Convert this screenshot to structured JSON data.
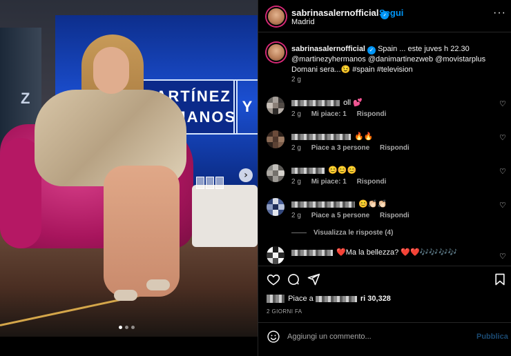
{
  "post": {
    "username": "sabrinasalernofficial",
    "follow_label": "Segui",
    "separator": "•",
    "location": "Madrid",
    "more_label": "···",
    "verified_mark": "✓",
    "caption_text": "Spain ... este juves h 22.30 @martinezyhermanos @danimartinezweb @movistarplus Domani sera...😉 #spain #television",
    "caption_time": "2 g"
  },
  "photo": {
    "sign_line1": "MARTÍNEZ",
    "sign_line2": "HERMANOS",
    "sign_y": "Y",
    "wall_letter": "Z",
    "next_icon": "›"
  },
  "comments": [
    {
      "text_suffix": "oll 💕",
      "time": "2 g",
      "likes": "Mi piace: 1",
      "reply": "Rispondi"
    },
    {
      "text_suffix": "🔥🔥",
      "time": "2 g",
      "likes": "Piace a 3 persone",
      "reply": "Rispondi"
    },
    {
      "text_suffix": "😊😊😊",
      "time": "2 g",
      "likes": "Mi piace: 1",
      "reply": "Rispondi"
    },
    {
      "text_suffix": "😊👏🏻👏🏻",
      "time": "2 g",
      "likes": "Piace a 5 persone",
      "reply": "Rispondi"
    },
    {
      "text_suffix": "❤️Ma la bellezza? ❤️❤️🎶🎶🎶🎶",
      "time": "",
      "likes": "",
      "reply": ""
    }
  ],
  "replies_label": "Visualizza le risposte (4)",
  "likes": {
    "prefix": "Piace a",
    "suffix": "ri 30,328"
  },
  "time_ago": "2 GIORNI FA",
  "comment_box": {
    "placeholder": "Aggiungi un commento...",
    "publish_label": "Pubblica"
  },
  "colors": {
    "accent": "#0095f6",
    "background": "#000000",
    "secondary_text": "#a8a8a8"
  }
}
